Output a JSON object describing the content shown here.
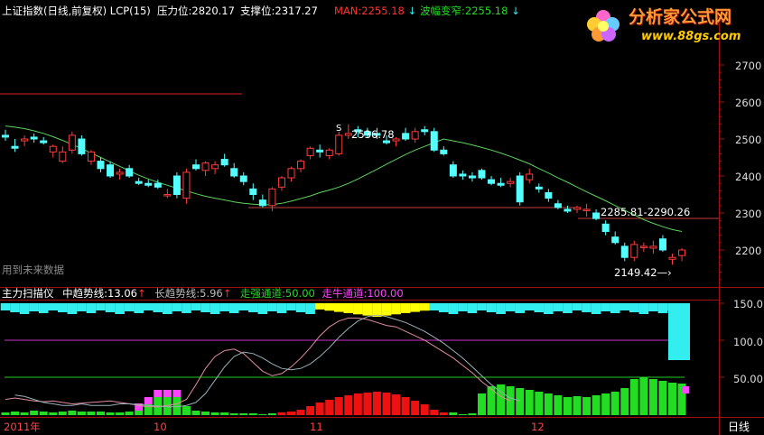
{
  "header": {
    "index_name": "上证指数(日线,前复权)",
    "lcp": "LCP(15)",
    "resistance_label": "压力位:",
    "resistance_value": "2820.17",
    "support_label": "支撑位:",
    "support_value": "2317.27",
    "man_label": "MAN:",
    "man_value": "2255.18",
    "wave_label": "波幅变窄:",
    "wave_value": "2255.18"
  },
  "logo": {
    "title": "分析家公式网",
    "url": "www.88gs.com"
  },
  "annotations": {
    "peak_label": "2536.78",
    "channel_label": "2285.81-2290.26",
    "low_label": "2149.42",
    "watermark": "用到未来数据"
  },
  "lower_header": {
    "name": "主力扫描仪",
    "mid_trend_label": "中趋势线:",
    "mid_trend_value": "13.06",
    "long_trend_label": "长趋势线:",
    "long_trend_value": "5.96",
    "strong_channel_label": "走强通道:",
    "strong_channel_value": "50.00",
    "bull_channel_label": "走牛通道:",
    "bull_channel_value": "100.00"
  },
  "axis": {
    "price_ticks": [
      "2700",
      "2600",
      "2500",
      "2400",
      "2300",
      "2200"
    ],
    "indicator_ticks": [
      "150.0",
      "100.0",
      "50.00"
    ],
    "months": [
      "2011年",
      "10",
      "11",
      "12"
    ],
    "period_button": "日线"
  },
  "colors": {
    "up": "#ff3c3c",
    "down": "#54ffff",
    "ma": "#5bd35b",
    "indicator_green": "#22dd22",
    "indicator_red": "#ee1111",
    "indicator_magenta": "#ff44ff",
    "indicator_yellow": "#ffff00",
    "indicator_cyan": "#33eeee"
  },
  "chart_data": {
    "type": "candlestick",
    "y_range": [
      2140,
      2760
    ],
    "candles": [
      [
        2510,
        2525,
        2495,
        2505
      ],
      [
        2480,
        2500,
        2465,
        2475
      ],
      [
        2495,
        2510,
        2480,
        2500
      ],
      [
        2505,
        2515,
        2490,
        2500
      ],
      [
        2495,
        2505,
        2485,
        2490
      ],
      [
        2465,
        2485,
        2450,
        2480
      ],
      [
        2440,
        2480,
        2435,
        2465
      ],
      [
        2470,
        2520,
        2460,
        2510
      ],
      [
        2500,
        2510,
        2455,
        2460
      ],
      [
        2440,
        2470,
        2430,
        2465
      ],
      [
        2440,
        2450,
        2410,
        2420
      ],
      [
        2430,
        2440,
        2395,
        2400
      ],
      [
        2405,
        2420,
        2390,
        2410
      ],
      [
        2420,
        2430,
        2395,
        2400
      ],
      [
        2385,
        2395,
        2375,
        2380
      ],
      [
        2380,
        2390,
        2370,
        2375
      ],
      [
        2380,
        2390,
        2365,
        2370
      ],
      [
        2350,
        2365,
        2340,
        2350
      ],
      [
        2400,
        2410,
        2340,
        2350
      ],
      [
        2340,
        2420,
        2325,
        2410
      ],
      [
        2430,
        2445,
        2415,
        2420
      ],
      [
        2415,
        2440,
        2400,
        2435
      ],
      [
        2420,
        2440,
        2405,
        2430
      ],
      [
        2445,
        2460,
        2425,
        2430
      ],
      [
        2420,
        2435,
        2395,
        2400
      ],
      [
        2400,
        2410,
        2375,
        2385
      ],
      [
        2365,
        2380,
        2335,
        2350
      ],
      [
        2335,
        2350,
        2315,
        2320
      ],
      [
        2320,
        2370,
        2305,
        2365
      ],
      [
        2370,
        2400,
        2360,
        2395
      ],
      [
        2395,
        2425,
        2385,
        2420
      ],
      [
        2420,
        2445,
        2410,
        2440
      ],
      [
        2455,
        2480,
        2445,
        2475
      ],
      [
        2470,
        2485,
        2450,
        2465
      ],
      [
        2455,
        2475,
        2445,
        2470
      ],
      [
        2460,
        2520,
        2455,
        2510
      ],
      [
        2510,
        2540,
        2500,
        2515
      ],
      [
        2525,
        2535,
        2505,
        2520
      ],
      [
        2520,
        2530,
        2505,
        2510
      ],
      [
        2515,
        2530,
        2500,
        2510
      ],
      [
        2495,
        2510,
        2485,
        2490
      ],
      [
        2495,
        2505,
        2480,
        2500
      ],
      [
        2515,
        2530,
        2495,
        2500
      ],
      [
        2500,
        2530,
        2490,
        2520
      ],
      [
        2525,
        2535,
        2510,
        2520
      ],
      [
        2520,
        2530,
        2465,
        2470
      ],
      [
        2470,
        2480,
        2455,
        2460
      ],
      [
        2430,
        2440,
        2395,
        2400
      ],
      [
        2405,
        2415,
        2390,
        2400
      ],
      [
        2400,
        2410,
        2385,
        2395
      ],
      [
        2415,
        2420,
        2390,
        2395
      ],
      [
        2390,
        2400,
        2375,
        2380
      ],
      [
        2380,
        2395,
        2370,
        2375
      ],
      [
        2380,
        2395,
        2370,
        2385
      ],
      [
        2400,
        2410,
        2320,
        2330
      ],
      [
        2390,
        2420,
        2380,
        2405
      ],
      [
        2370,
        2380,
        2355,
        2365
      ],
      [
        2355,
        2365,
        2330,
        2340
      ],
      [
        2325,
        2335,
        2310,
        2315
      ],
      [
        2310,
        2320,
        2300,
        2305
      ],
      [
        2310,
        2320,
        2300,
        2315
      ],
      [
        2310,
        2325,
        2290,
        2310
      ],
      [
        2300,
        2310,
        2280,
        2285
      ],
      [
        2270,
        2280,
        2240,
        2250
      ],
      [
        2235,
        2250,
        2215,
        2220
      ],
      [
        2210,
        2220,
        2170,
        2180
      ],
      [
        2180,
        2225,
        2170,
        2215
      ],
      [
        2210,
        2220,
        2195,
        2210
      ],
      [
        2205,
        2225,
        2190,
        2210
      ],
      [
        2230,
        2240,
        2195,
        2200
      ],
      [
        2175,
        2190,
        2160,
        2180
      ],
      [
        2185,
        2205,
        2170,
        2200
      ]
    ],
    "ma_line": [
      2535,
      2532,
      2528,
      2522,
      2515,
      2506,
      2496,
      2485,
      2474,
      2462,
      2450,
      2438,
      2426,
      2414,
      2402,
      2392,
      2383,
      2375,
      2367,
      2360,
      2352,
      2345,
      2340,
      2335,
      2330,
      2326,
      2324,
      2322,
      2323,
      2326,
      2332,
      2339,
      2346,
      2355,
      2362,
      2370,
      2380,
      2392,
      2405,
      2418,
      2432,
      2445,
      2458,
      2470,
      2480,
      2490,
      2500,
      2495,
      2490,
      2484,
      2477,
      2470,
      2462,
      2453,
      2443,
      2433,
      2420,
      2408,
      2395,
      2383,
      2370,
      2357,
      2345,
      2333,
      2320,
      2307,
      2295,
      2282,
      2272,
      2263,
      2255,
      2250
    ]
  }
}
